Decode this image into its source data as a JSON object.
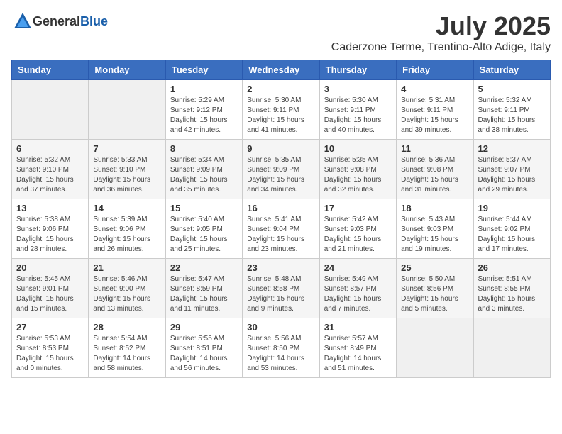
{
  "logo": {
    "general": "General",
    "blue": "Blue"
  },
  "header": {
    "month_year": "July 2025",
    "location": "Caderzone Terme, Trentino-Alto Adige, Italy"
  },
  "days_of_week": [
    "Sunday",
    "Monday",
    "Tuesday",
    "Wednesday",
    "Thursday",
    "Friday",
    "Saturday"
  ],
  "weeks": [
    [
      {
        "day": "",
        "info": ""
      },
      {
        "day": "",
        "info": ""
      },
      {
        "day": "1",
        "info": "Sunrise: 5:29 AM\nSunset: 9:12 PM\nDaylight: 15 hours and 42 minutes."
      },
      {
        "day": "2",
        "info": "Sunrise: 5:30 AM\nSunset: 9:11 PM\nDaylight: 15 hours and 41 minutes."
      },
      {
        "day": "3",
        "info": "Sunrise: 5:30 AM\nSunset: 9:11 PM\nDaylight: 15 hours and 40 minutes."
      },
      {
        "day": "4",
        "info": "Sunrise: 5:31 AM\nSunset: 9:11 PM\nDaylight: 15 hours and 39 minutes."
      },
      {
        "day": "5",
        "info": "Sunrise: 5:32 AM\nSunset: 9:11 PM\nDaylight: 15 hours and 38 minutes."
      }
    ],
    [
      {
        "day": "6",
        "info": "Sunrise: 5:32 AM\nSunset: 9:10 PM\nDaylight: 15 hours and 37 minutes."
      },
      {
        "day": "7",
        "info": "Sunrise: 5:33 AM\nSunset: 9:10 PM\nDaylight: 15 hours and 36 minutes."
      },
      {
        "day": "8",
        "info": "Sunrise: 5:34 AM\nSunset: 9:09 PM\nDaylight: 15 hours and 35 minutes."
      },
      {
        "day": "9",
        "info": "Sunrise: 5:35 AM\nSunset: 9:09 PM\nDaylight: 15 hours and 34 minutes."
      },
      {
        "day": "10",
        "info": "Sunrise: 5:35 AM\nSunset: 9:08 PM\nDaylight: 15 hours and 32 minutes."
      },
      {
        "day": "11",
        "info": "Sunrise: 5:36 AM\nSunset: 9:08 PM\nDaylight: 15 hours and 31 minutes."
      },
      {
        "day": "12",
        "info": "Sunrise: 5:37 AM\nSunset: 9:07 PM\nDaylight: 15 hours and 29 minutes."
      }
    ],
    [
      {
        "day": "13",
        "info": "Sunrise: 5:38 AM\nSunset: 9:06 PM\nDaylight: 15 hours and 28 minutes."
      },
      {
        "day": "14",
        "info": "Sunrise: 5:39 AM\nSunset: 9:06 PM\nDaylight: 15 hours and 26 minutes."
      },
      {
        "day": "15",
        "info": "Sunrise: 5:40 AM\nSunset: 9:05 PM\nDaylight: 15 hours and 25 minutes."
      },
      {
        "day": "16",
        "info": "Sunrise: 5:41 AM\nSunset: 9:04 PM\nDaylight: 15 hours and 23 minutes."
      },
      {
        "day": "17",
        "info": "Sunrise: 5:42 AM\nSunset: 9:03 PM\nDaylight: 15 hours and 21 minutes."
      },
      {
        "day": "18",
        "info": "Sunrise: 5:43 AM\nSunset: 9:03 PM\nDaylight: 15 hours and 19 minutes."
      },
      {
        "day": "19",
        "info": "Sunrise: 5:44 AM\nSunset: 9:02 PM\nDaylight: 15 hours and 17 minutes."
      }
    ],
    [
      {
        "day": "20",
        "info": "Sunrise: 5:45 AM\nSunset: 9:01 PM\nDaylight: 15 hours and 15 minutes."
      },
      {
        "day": "21",
        "info": "Sunrise: 5:46 AM\nSunset: 9:00 PM\nDaylight: 15 hours and 13 minutes."
      },
      {
        "day": "22",
        "info": "Sunrise: 5:47 AM\nSunset: 8:59 PM\nDaylight: 15 hours and 11 minutes."
      },
      {
        "day": "23",
        "info": "Sunrise: 5:48 AM\nSunset: 8:58 PM\nDaylight: 15 hours and 9 minutes."
      },
      {
        "day": "24",
        "info": "Sunrise: 5:49 AM\nSunset: 8:57 PM\nDaylight: 15 hours and 7 minutes."
      },
      {
        "day": "25",
        "info": "Sunrise: 5:50 AM\nSunset: 8:56 PM\nDaylight: 15 hours and 5 minutes."
      },
      {
        "day": "26",
        "info": "Sunrise: 5:51 AM\nSunset: 8:55 PM\nDaylight: 15 hours and 3 minutes."
      }
    ],
    [
      {
        "day": "27",
        "info": "Sunrise: 5:53 AM\nSunset: 8:53 PM\nDaylight: 15 hours and 0 minutes."
      },
      {
        "day": "28",
        "info": "Sunrise: 5:54 AM\nSunset: 8:52 PM\nDaylight: 14 hours and 58 minutes."
      },
      {
        "day": "29",
        "info": "Sunrise: 5:55 AM\nSunset: 8:51 PM\nDaylight: 14 hours and 56 minutes."
      },
      {
        "day": "30",
        "info": "Sunrise: 5:56 AM\nSunset: 8:50 PM\nDaylight: 14 hours and 53 minutes."
      },
      {
        "day": "31",
        "info": "Sunrise: 5:57 AM\nSunset: 8:49 PM\nDaylight: 14 hours and 51 minutes."
      },
      {
        "day": "",
        "info": ""
      },
      {
        "day": "",
        "info": ""
      }
    ]
  ]
}
